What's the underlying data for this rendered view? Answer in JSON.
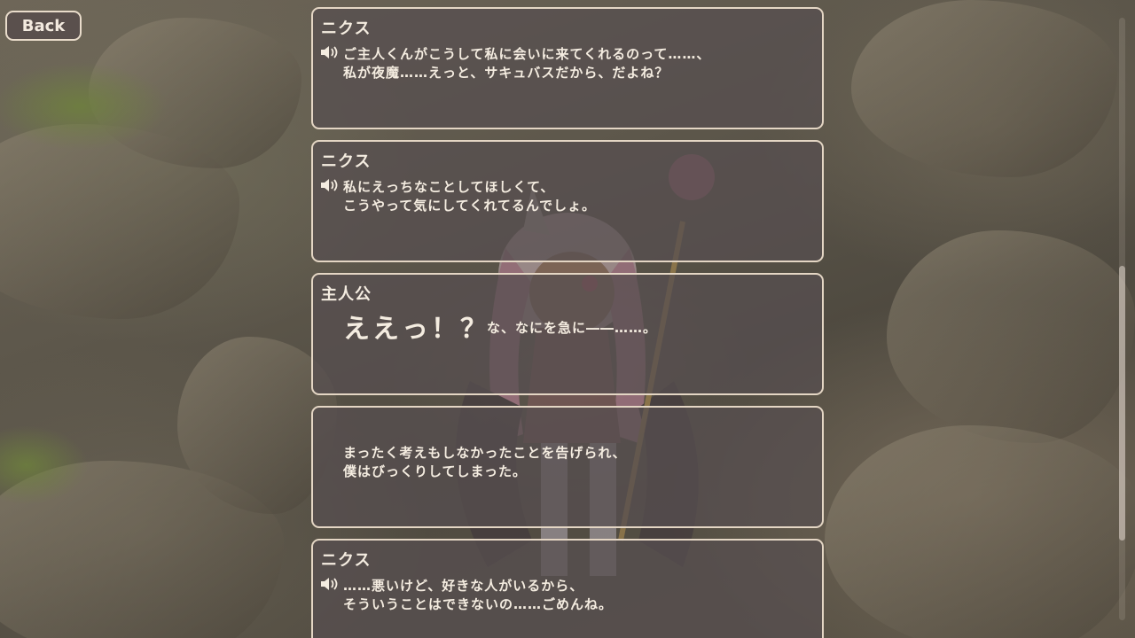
{
  "back_label": "Back",
  "entries": [
    {
      "speaker": "ニクス",
      "voice_icon": "speaker-icon",
      "line1": "ご主人くんがこうして私に会いに来てくれるのって……、",
      "line2": "私が夜魔……えっと、サキュバスだから、だよね？"
    },
    {
      "speaker": "ニクス",
      "voice_icon": "speaker-icon",
      "line1": "私にえっちなことしてほしくて、",
      "line2": "こうやって気にしてくれてるんでしょ。"
    },
    {
      "speaker": "主人公",
      "line_big": "ええっ！？",
      "line_small": "な、なにを急に――……。"
    },
    {
      "speaker": "",
      "line1": "まったく考えもしなかったことを告げられ、",
      "line2": "僕はびっくりしてしまった。"
    },
    {
      "speaker": "ニクス",
      "voice_icon": "speaker-icon",
      "line1": "……悪いけど、好きな人がいるから、",
      "line2": "そういうことはできないの……ごめんね。"
    }
  ],
  "colors": {
    "panel_border": "#e4d6c4",
    "panel_fill": "#564e50",
    "text": "#f4ece0"
  }
}
